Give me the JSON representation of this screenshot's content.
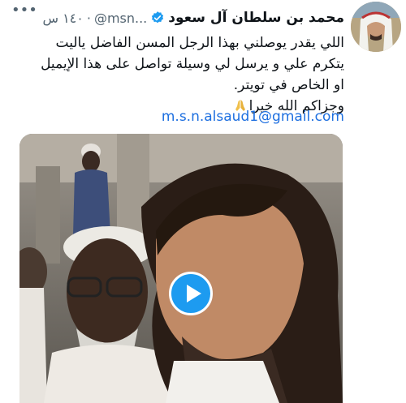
{
  "author": {
    "name": "محمد بن سلطان آل سعود",
    "handle": "@msn...",
    "separator": "·",
    "time": "١٤٠ س",
    "verified": true
  },
  "tweet": {
    "lines": [
      "اللي يقدر يوصلني بهذا الرجل المسن الفاضل ياليت",
      "يتكرم علي و يرسل لي وسيلة تواصل على هذا الإيميل",
      "او الخاص في تويتر.",
      "وجزاكم الله خيرا"
    ],
    "email": "m.s.n.alsaud1@gmail.com"
  },
  "icons": {
    "more": "more-options-icon",
    "verified": "verified-badge-icon",
    "play": "play-icon",
    "praying_hands": "praying-hands-emoji"
  },
  "colors": {
    "accent": "#1d9bf0",
    "link": "#1d6fe0",
    "muted": "#536471",
    "text": "#0f1419"
  }
}
